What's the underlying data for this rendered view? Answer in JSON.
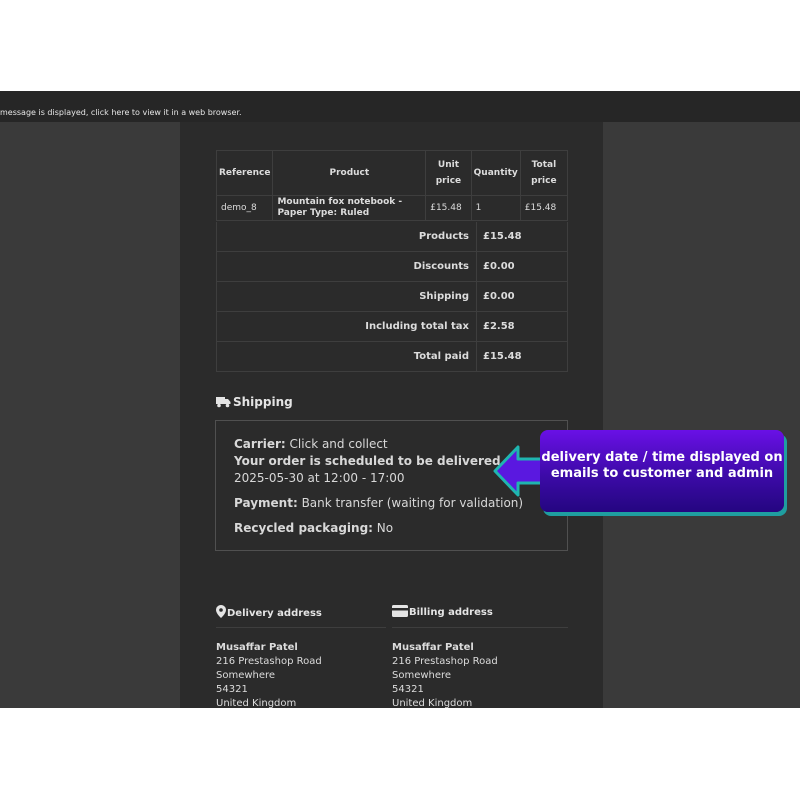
{
  "topbar": {
    "text": "message is displayed, click here to view it in a web browser."
  },
  "table": {
    "headers": [
      "Reference",
      "Product",
      "Unit price",
      "Quantity",
      "Total price"
    ],
    "row": {
      "reference": "demo_8",
      "product": "Mountain fox notebook - Paper Type: Ruled",
      "unit_price": "£15.48",
      "quantity": "1",
      "total_price": "£15.48"
    }
  },
  "totals": [
    {
      "label": "Products",
      "value": "£15.48"
    },
    {
      "label": "Discounts",
      "value": "£0.00"
    },
    {
      "label": "Shipping",
      "value": "£0.00"
    },
    {
      "label": "Including total tax",
      "value": "£2.58"
    },
    {
      "label": "Total paid",
      "value": "£15.48"
    }
  ],
  "shipping": {
    "heading": "Shipping",
    "carrier_label": "Carrier:",
    "carrier_value": "Click and collect",
    "scheduled_label": "Your order is scheduled to be delivered on:",
    "scheduled_value": "2025-05-30 at 12:00 - 17:00",
    "payment_label": "Payment:",
    "payment_value": "Bank transfer (waiting for validation)",
    "recycled_label": "Recycled packaging:",
    "recycled_value": "No"
  },
  "delivery_address": {
    "heading": "Delivery address",
    "name": "Musaffar Patel",
    "line1": "216 Prestashop Road",
    "line2": "Somewhere",
    "postcode": "54321",
    "country": "United Kingdom"
  },
  "billing_address": {
    "heading": "Billing address",
    "name": "Musaffar Patel",
    "line1": "216 Prestashop Road",
    "line2": "Somewhere",
    "postcode": "54321",
    "country": "United Kingdom"
  },
  "callout": {
    "text": "delivery date / time displayed on emails to customer and admin"
  },
  "icons": {
    "truck": "truck-icon",
    "location": "location-pin-icon",
    "card": "credit-card-icon",
    "arrow": "arrow-left-icon"
  },
  "colors": {
    "callout_top": "#6a10e6",
    "callout_bottom": "#240680",
    "callout_shadow": "#1f9ea0",
    "arrow_fill": "#5a18e0",
    "arrow_outline": "#1fb5b0"
  }
}
